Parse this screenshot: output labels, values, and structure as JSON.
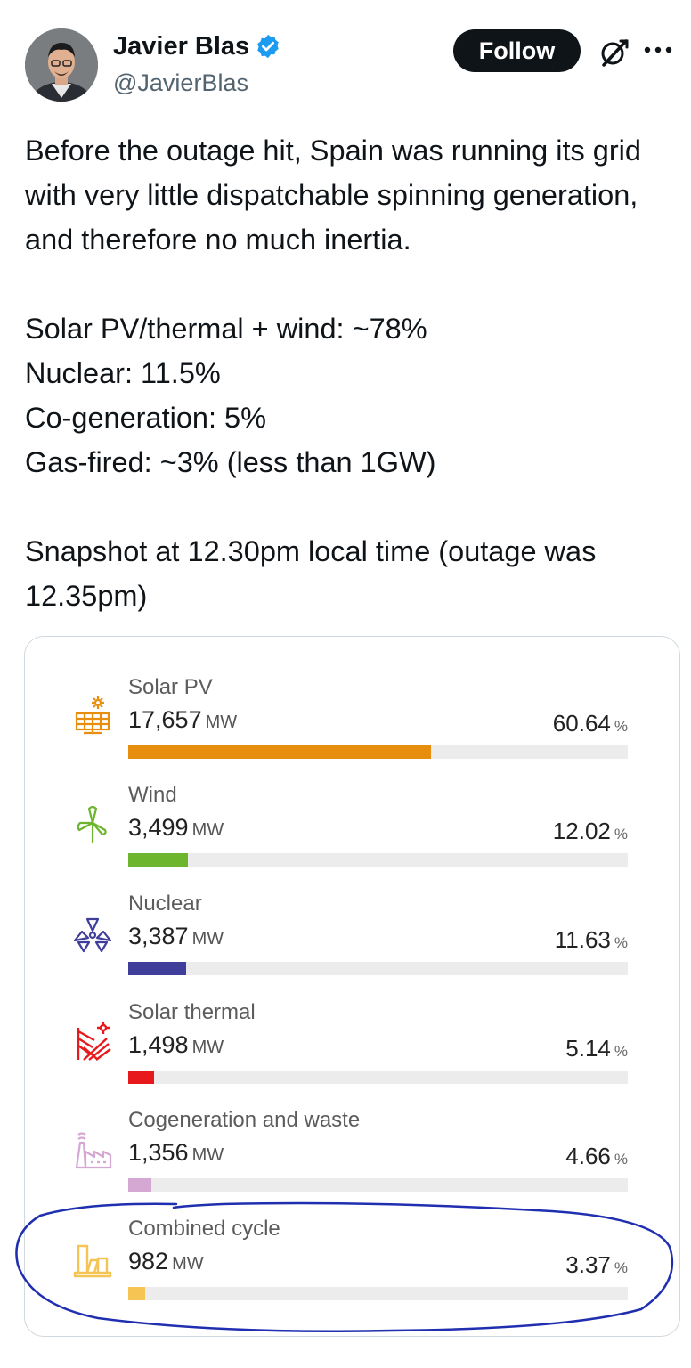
{
  "author": {
    "display_name": "Javier Blas",
    "handle": "@JavierBlas",
    "verified": true
  },
  "header": {
    "follow_label": "Follow",
    "grok_icon": "grok-icon",
    "more_icon": "more-icon"
  },
  "tweet": {
    "paragraphs": [
      "Before the outage hit, Spain was running its grid with very little dispatchable spinning generation, and therefore no much inertia.",
      "Solar PV/thermal + wind: ~78%\nNuclear: 11.5%\nCo-generation: 5%\nGas-fired: ~3% (less than 1GW)",
      "Snapshot at 12.30pm local time (outage was 12.35pm)"
    ]
  },
  "media": {
    "items": [
      {
        "name": "Solar PV",
        "value": "17,657",
        "unit": "MW",
        "pct": "60.64",
        "pct_unit": "%",
        "fraction": 0.6064,
        "color": "#e88e0e",
        "icon": "solar-panel-icon"
      },
      {
        "name": "Wind",
        "value": "3,499",
        "unit": "MW",
        "pct": "12.02",
        "pct_unit": "%",
        "fraction": 0.1202,
        "color": "#6cb52d",
        "icon": "wind-turbine-icon"
      },
      {
        "name": "Nuclear",
        "value": "3,387",
        "unit": "MW",
        "pct": "11.63",
        "pct_unit": "%",
        "fraction": 0.1163,
        "color": "#3f3f9b",
        "icon": "nuclear-icon"
      },
      {
        "name": "Solar thermal",
        "value": "1,498",
        "unit": "MW",
        "pct": "5.14",
        "pct_unit": "%",
        "fraction": 0.0514,
        "color": "#e8191c",
        "icon": "solar-thermal-icon"
      },
      {
        "name": "Cogeneration and waste",
        "value": "1,356",
        "unit": "MW",
        "pct": "4.66",
        "pct_unit": "%",
        "fraction": 0.0466,
        "color": "#d5a8d4",
        "icon": "cogeneration-icon"
      },
      {
        "name": "Combined cycle",
        "value": "982",
        "unit": "MW",
        "pct": "3.37",
        "pct_unit": "%",
        "fraction": 0.0337,
        "color": "#f5c452",
        "icon": "combined-cycle-icon"
      }
    ],
    "annotation_color": "#1f2fb0"
  }
}
